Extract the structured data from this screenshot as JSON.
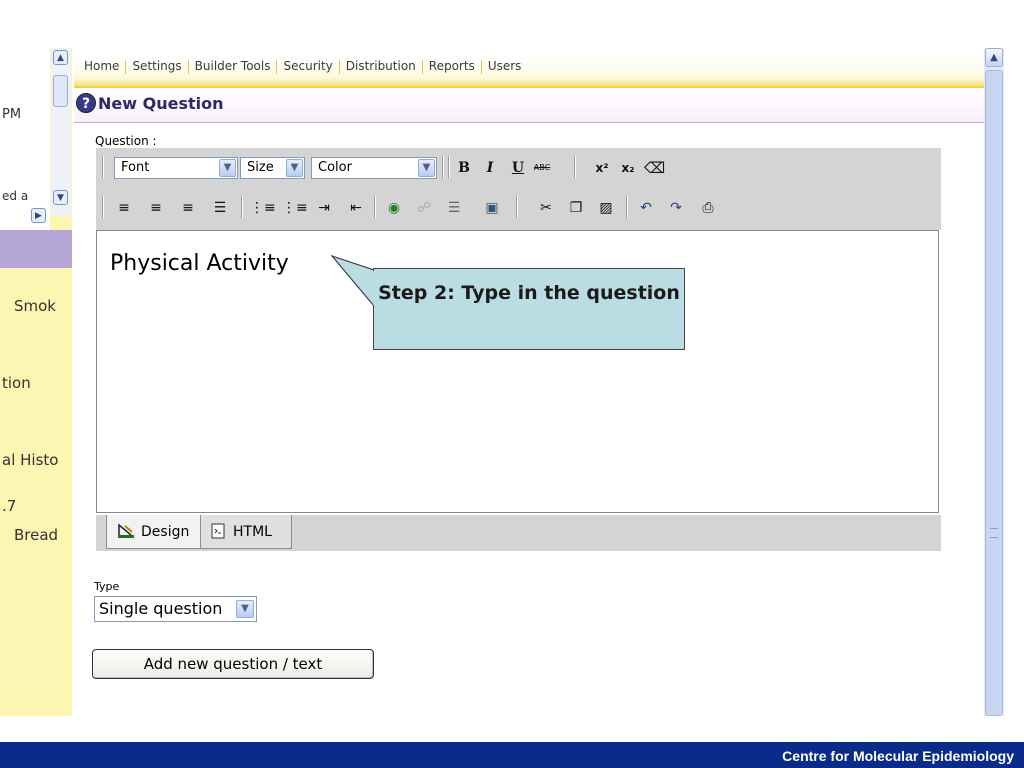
{
  "left_panel": {
    "items": [
      {
        "text": "PM"
      },
      {
        "text": "ed a"
      },
      {
        "text": "Smok"
      },
      {
        "text": "tion"
      },
      {
        "text": "al Histo"
      },
      {
        "text": ".7"
      },
      {
        "text": "Bread"
      }
    ]
  },
  "nav": {
    "items": [
      "Home",
      "Settings",
      "Builder Tools",
      "Security",
      "Distribution",
      "Reports",
      "Users"
    ]
  },
  "header": {
    "title": "New Question",
    "help_glyph": "?"
  },
  "question": {
    "label": "Question :"
  },
  "toolbar": {
    "font_value": "Font",
    "size_value": "Size",
    "color_value": "Color"
  },
  "editor": {
    "text": "Physical Activity"
  },
  "callout": {
    "text": "Step 2: Type in the question"
  },
  "tabs": [
    {
      "label": "Design"
    },
    {
      "label": "HTML"
    }
  ],
  "type": {
    "label": "Type",
    "selected": "Single question"
  },
  "add_button": {
    "label": "Add new question / text"
  },
  "footer": {
    "text": "Centre for Molecular Epidemiology"
  },
  "colors": {
    "footer_bg": "#0b2b8a",
    "left_panel_bg": "#fdf6b2",
    "callout_bg": "#b9dde2",
    "nav_accent": "#f3e27a",
    "title_color": "#2b2b64"
  }
}
